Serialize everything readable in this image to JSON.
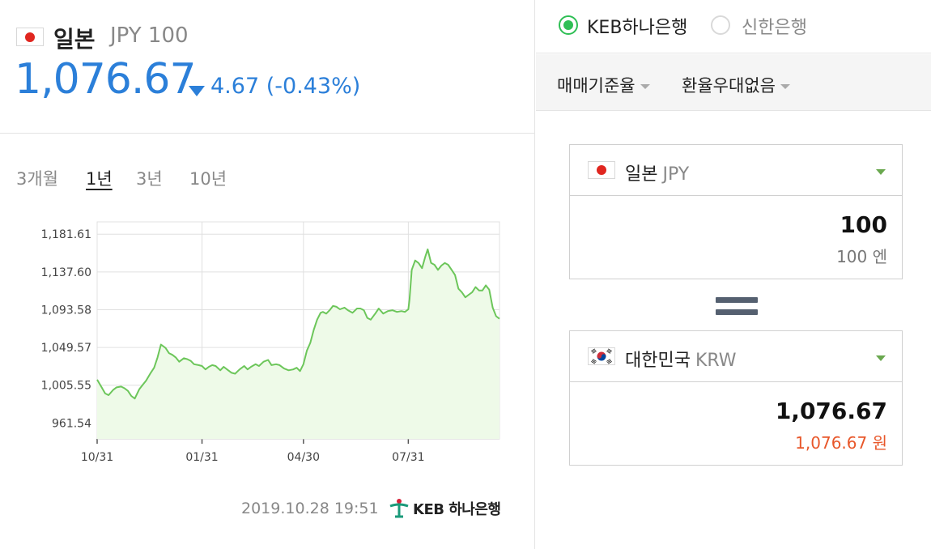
{
  "header": {
    "country": "일본",
    "currency": "JPY 100",
    "rate": "1,076.67",
    "change": "4.67 (-0.43%)",
    "change_direction": "down"
  },
  "periods": [
    "3개월",
    "1년",
    "3년",
    "10년"
  ],
  "active_period": "1년",
  "chart_data": {
    "type": "area",
    "title": "",
    "xlabel": "",
    "ylabel": "",
    "ylim": [
      943,
      1196
    ],
    "yticks": [
      "1,181.61",
      "1,137.60",
      "1,093.58",
      "1,049.57",
      "1,005.55",
      "961.54"
    ],
    "ytick_values": [
      1181.61,
      1137.6,
      1093.58,
      1049.57,
      1005.55,
      961.54
    ],
    "xticks": [
      "10/31",
      "01/31",
      "04/30",
      "07/31"
    ],
    "x_days": [
      0,
      92,
      181,
      273
    ],
    "x_range_days": [
      0,
      353
    ],
    "grid": true,
    "colors": {
      "line": "#6cc65a",
      "fill": "#eefae8",
      "grid": "#e0e0e0"
    },
    "series": [
      {
        "x": [
          0,
          4,
          7,
          10,
          14,
          17,
          21,
          24,
          27,
          30,
          33,
          37,
          40,
          43,
          47,
          50,
          53,
          56,
          60,
          63,
          66,
          69,
          72,
          76,
          79,
          82,
          85,
          89,
          92,
          95,
          98,
          101,
          104,
          108,
          111,
          115,
          118,
          121,
          125,
          129,
          132,
          135,
          139,
          142,
          146,
          150,
          153,
          157,
          160,
          164,
          168,
          172,
          175,
          178,
          181,
          184,
          187,
          190,
          193,
          196,
          198,
          201,
          204,
          207,
          210,
          213,
          217,
          220,
          224,
          228,
          231,
          234,
          237,
          240,
          244,
          247,
          251,
          255,
          259,
          263,
          267,
          270,
          273,
          274,
          276,
          279,
          282,
          285,
          288,
          290,
          293,
          296,
          299,
          302,
          305,
          308,
          311,
          314,
          317,
          320,
          323,
          326,
          329,
          332,
          335,
          338,
          341,
          344,
          347,
          350,
          353
        ],
        "y": [
          1012,
          1003,
          996,
          994,
          1000,
          1003,
          1004,
          1002,
          999,
          993,
          990,
          1001,
          1006,
          1011,
          1020,
          1026,
          1038,
          1053,
          1049,
          1043,
          1041,
          1038,
          1033,
          1037,
          1036,
          1034,
          1030,
          1029,
          1028,
          1024,
          1027,
          1029,
          1028,
          1023,
          1027,
          1023,
          1020,
          1019,
          1024,
          1028,
          1024,
          1027,
          1030,
          1028,
          1033,
          1035,
          1029,
          1030,
          1029,
          1025,
          1023,
          1024,
          1026,
          1022,
          1030,
          1046,
          1055,
          1070,
          1082,
          1090,
          1091,
          1089,
          1093,
          1098,
          1097,
          1094,
          1096,
          1093,
          1090,
          1095,
          1095,
          1093,
          1084,
          1082,
          1089,
          1095,
          1089,
          1092,
          1093,
          1091,
          1092,
          1091,
          1094,
          1105,
          1140,
          1151,
          1148,
          1142,
          1156,
          1164,
          1148,
          1146,
          1140,
          1145,
          1148,
          1146,
          1140,
          1134,
          1118,
          1114,
          1108,
          1111,
          1114,
          1120,
          1116,
          1116,
          1122,
          1117,
          1096,
          1086,
          1083
        ]
      }
    ]
  },
  "timestamp": "2019.10.28 19:51",
  "bank_logo_text": "KEB 하나은행",
  "bank_options": [
    {
      "label": "KEB하나은행",
      "selected": true
    },
    {
      "label": "신한은행",
      "selected": false
    }
  ],
  "options": [
    {
      "label": "매매기준율"
    },
    {
      "label": "환율우대없음"
    }
  ],
  "converter": {
    "from": {
      "country": "일본",
      "code": "JPY",
      "value": "100",
      "sub": "100 엔"
    },
    "to": {
      "country": "대한민국",
      "code": "KRW",
      "value": "1,076.67",
      "sub": "1,076.67 원"
    }
  }
}
